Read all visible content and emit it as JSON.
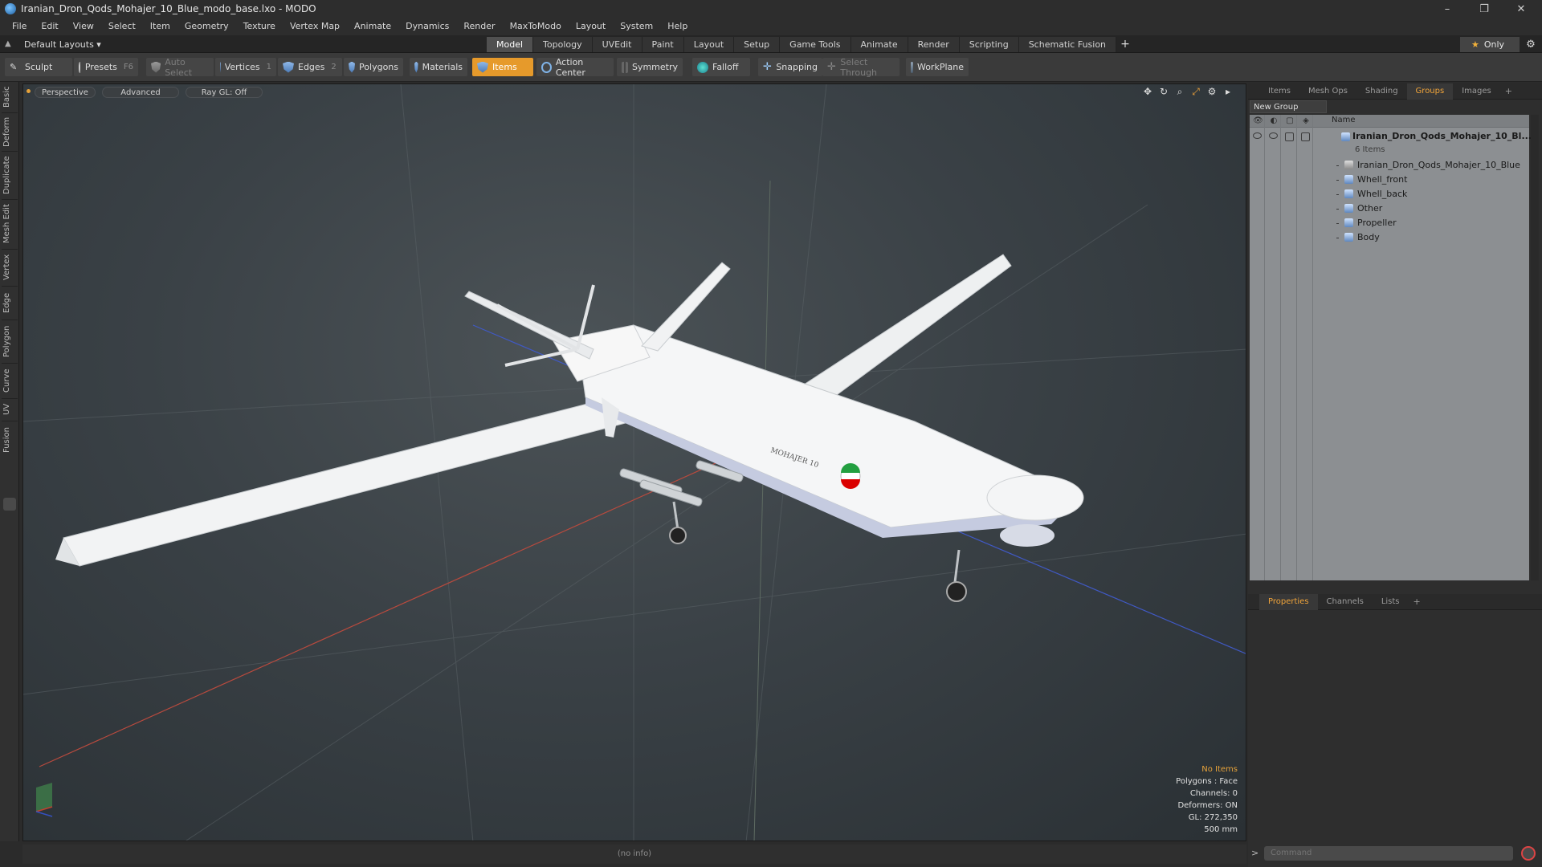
{
  "window": {
    "title": "Iranian_Dron_Qods_Mohajer_10_Blue_modo_base.lxo - MODO",
    "minimize": "–",
    "restore": "❐",
    "close": "✕"
  },
  "menu": [
    "File",
    "Edit",
    "View",
    "Select",
    "Item",
    "Geometry",
    "Texture",
    "Vertex Map",
    "Animate",
    "Dynamics",
    "Render",
    "MaxToModo",
    "Layout",
    "System",
    "Help"
  ],
  "layouts": {
    "label": "Default Layouts ▾"
  },
  "tabs": [
    "Model",
    "Topology",
    "UVEdit",
    "Paint",
    "Layout",
    "Setup",
    "Game Tools",
    "Animate",
    "Render",
    "Scripting",
    "Schematic Fusion"
  ],
  "tab_add": "+",
  "only": "Only",
  "toolbar": {
    "sculpt": "Sculpt",
    "presets": "Presets",
    "presets_key": "F6",
    "auto_select": "Auto Select",
    "vertices": "Vertices",
    "vertices_key": "1",
    "edges": "Edges",
    "edges_key": "2",
    "polygons": "Polygons",
    "materials": "Materials",
    "items": "Items",
    "action_center": "Action Center",
    "symmetry": "Symmetry",
    "falloff": "Falloff",
    "snapping": "Snapping",
    "select_through": "Select Through",
    "workplane": "WorkPlane"
  },
  "left_tabs": [
    "Basic",
    "Deform",
    "Duplicate",
    "Mesh Edit",
    "Vertex",
    "Edge",
    "Polygon",
    "Curve",
    "UV",
    "Fusion"
  ],
  "viewport": {
    "perspective": "Perspective",
    "advanced": "Advanced",
    "raygl": "Ray GL: Off",
    "info": {
      "no_items": "No Items",
      "polygons": "Polygons : Face",
      "channels": "Channels: 0",
      "deformers": "Deformers: ON",
      "gl": "GL: 272,350",
      "size": "500 mm"
    },
    "decal_text": "MOHAJER 10"
  },
  "status": "(no info)",
  "right_tabs": [
    "Items",
    "Mesh Ops",
    "Shading",
    "Groups",
    "Images"
  ],
  "right_active": "Groups",
  "new_group": "New Group",
  "groups_header": "Name",
  "groups": {
    "root": "Iranian_Dron_Qods_Mohajer_10_Bl...",
    "root_sub": "6 Items",
    "children": [
      "Iranian_Dron_Qods_Mohajer_10_Blue",
      "Whell_front",
      "Whell_back",
      "Other",
      "Propeller",
      "Body"
    ]
  },
  "prop_tabs": [
    "Properties",
    "Channels",
    "Lists"
  ],
  "command_placeholder": "Command",
  "colors": {
    "accent": "#e69a2b",
    "viewport_bg": "#3a4146"
  }
}
